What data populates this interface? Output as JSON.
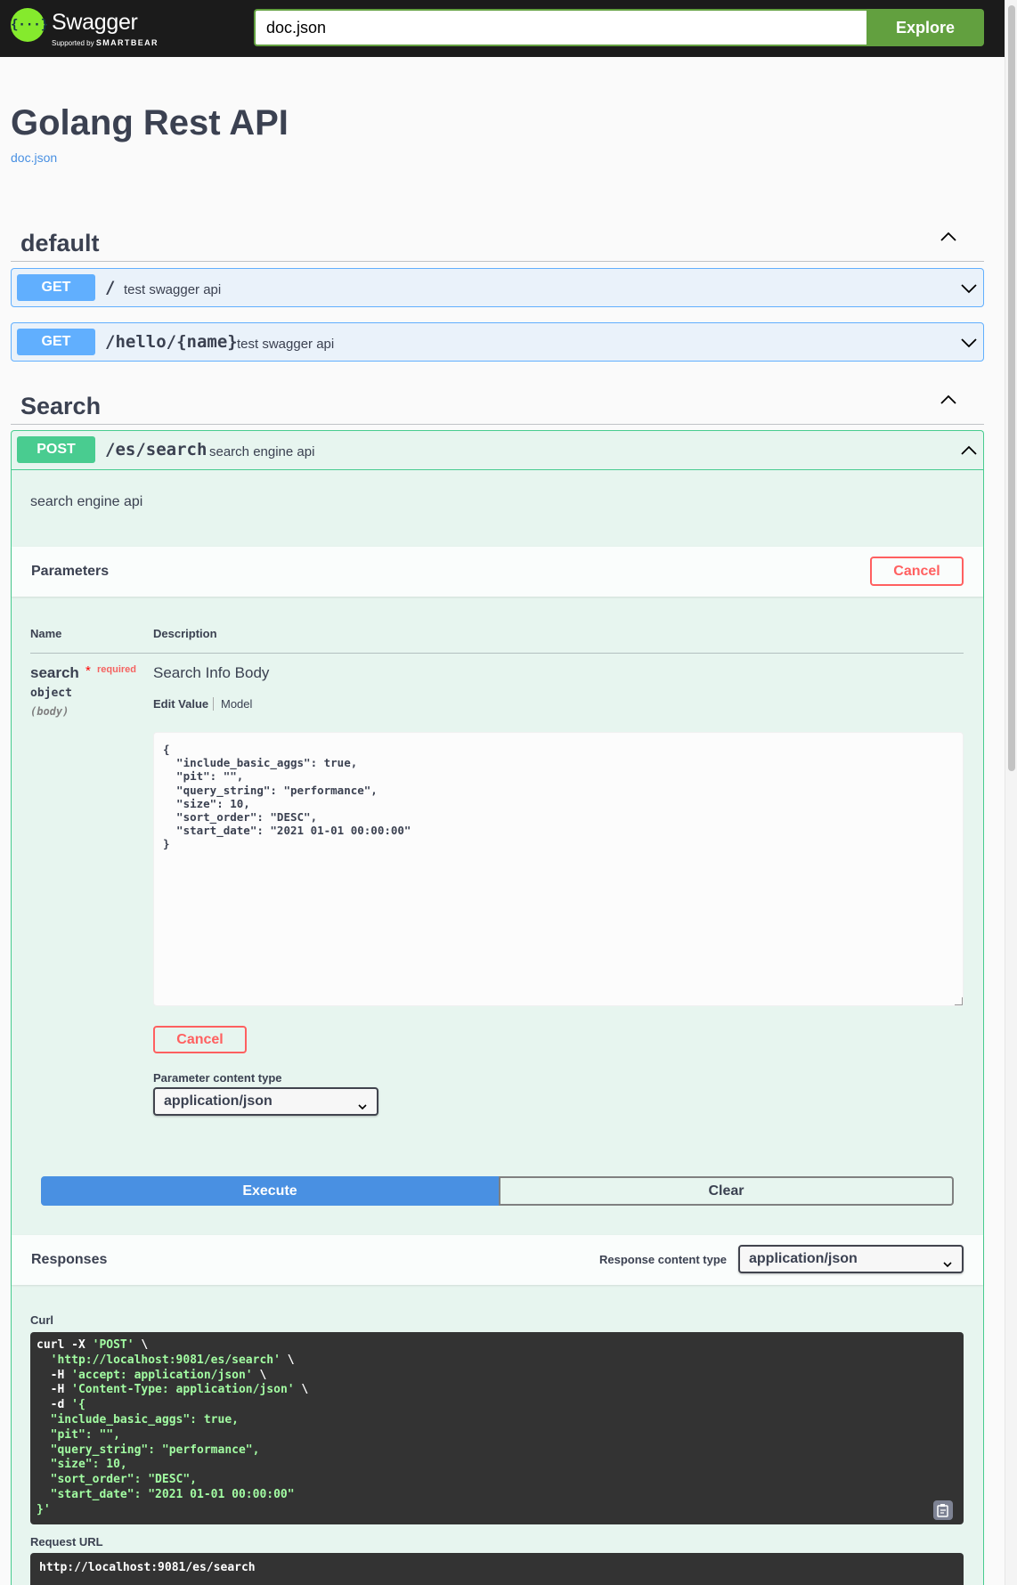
{
  "topbar": {
    "logo_title": "Swagger",
    "logo_sub_prefix": "Supported by",
    "logo_sub_brand": "SMARTBEAR",
    "url_value": "doc.json",
    "explore_label": "Explore",
    "brand_color": "#85ea2d",
    "accent_color": "#62a03f"
  },
  "info": {
    "title": "Golang Rest API",
    "link": "doc.json"
  },
  "tags": [
    {
      "name": "default",
      "operations": [
        {
          "method": "GET",
          "path": "/",
          "summary": "test swagger api"
        },
        {
          "method": "GET",
          "path": "/hello/{name}",
          "summary": "test swagger api"
        }
      ]
    },
    {
      "name": "Search",
      "operations": [
        {
          "method": "POST",
          "path": "/es/search",
          "summary": "search engine api"
        }
      ]
    }
  ],
  "post_op": {
    "description": "search engine api",
    "parameters_title": "Parameters",
    "cancel_label": "Cancel",
    "columns": {
      "name": "Name",
      "description": "Description"
    },
    "param": {
      "name": "search",
      "required_star": "*",
      "required_label": "required",
      "type": "object",
      "in": "(body)",
      "description": "Search Info Body",
      "tab_edit": "Edit Value",
      "tab_model": "Model",
      "body_value": "{\n  \"include_basic_aggs\": true,\n  \"pit\": \"\",\n  \"query_string\": \"performance\",\n  \"size\": 10,\n  \"sort_order\": \"DESC\",\n  \"start_date\": \"2021 01-01 00:00:00\"\n}",
      "body_cancel_label": "Cancel",
      "content_type_label": "Parameter content type",
      "content_type_value": "application/json"
    },
    "execute_label": "Execute",
    "clear_label": "Clear",
    "responses_title": "Responses",
    "response_ct_label": "Response content type",
    "response_ct_value": "application/json",
    "curl_label": "Curl",
    "curl_lines": [
      {
        "plain": "curl -X ",
        "str": "'POST'",
        "tail": " \\"
      },
      {
        "plain": "  ",
        "str": "'http://localhost:9081/es/search'",
        "tail": " \\"
      },
      {
        "plain": "  -H ",
        "str": "'accept: application/json'",
        "tail": " \\"
      },
      {
        "plain": "  -H ",
        "str": "'Content-Type: application/json'",
        "tail": " \\"
      },
      {
        "plain": "  -d ",
        "str": "'{",
        "tail": ""
      },
      {
        "plain": "",
        "str": "  \"include_basic_aggs\": true,",
        "tail": ""
      },
      {
        "plain": "",
        "str": "  \"pit\": \"\",",
        "tail": ""
      },
      {
        "plain": "",
        "str": "  \"query_string\": \"performance\",",
        "tail": ""
      },
      {
        "plain": "",
        "str": "  \"size\": 10,",
        "tail": ""
      },
      {
        "plain": "",
        "str": "  \"sort_order\": \"DESC\",",
        "tail": ""
      },
      {
        "plain": "",
        "str": "  \"start_date\": \"2021 01-01 00:00:00\"",
        "tail": ""
      },
      {
        "plain": "",
        "str": "}'",
        "tail": ""
      }
    ],
    "request_url_label": "Request URL",
    "request_url_value": "http://localhost:9081/es/search"
  },
  "colors": {
    "get": "#61affe",
    "post": "#49cc90",
    "execute": "#4990e2",
    "cancel": "#ff6060"
  },
  "icons": {
    "collapse": "chevron-up-icon",
    "expand": "chevron-down-icon",
    "copy": "clipboard-icon",
    "select": "caret-down-icon"
  }
}
